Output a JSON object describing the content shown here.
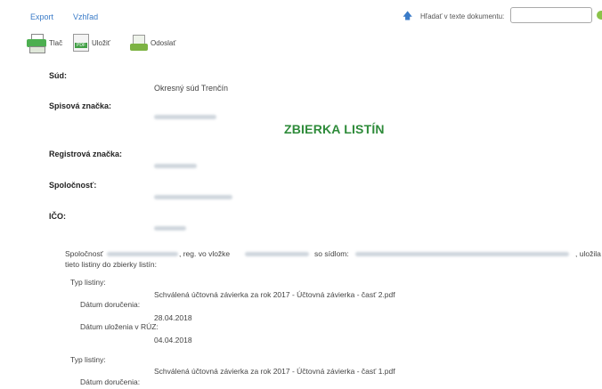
{
  "menu": {
    "export": "Export",
    "view": "Vzhľad"
  },
  "search": {
    "label": "Hľadať v texte dokumentu:",
    "value": "",
    "placeholder": ""
  },
  "toolbar": {
    "print": "Tlač",
    "save": "Uložiť",
    "send": "Odoslať",
    "save_icon_text": "PDF"
  },
  "title": "ZBIERKA LISTÍN",
  "fields": {
    "court_label": "Súd:",
    "court_value": "Okresný súd Trenčín",
    "file_label": "Spisová značka:",
    "reg_label": "Registrová značka:",
    "company_label": "Spoločnosť:",
    "ico_label": "IČO:"
  },
  "paragraph": {
    "part1": "Spoločnosť",
    "part2": ", reg. vo vložke",
    "part3": "so sídlom:",
    "part4": ", uložila",
    "line2": "tieto listiny do zbierky listín:"
  },
  "documents": {
    "labels": {
      "type": "Typ listiny:",
      "delivered": "Dátum doručenia:",
      "stored": "Dátum uloženia v RÚZ:"
    },
    "items": [
      {
        "type": "Schválená účtovná závierka za rok 2017 - Účtovná závierka - časť 2.pdf",
        "delivered": "28.04.2018",
        "stored": "04.04.2018"
      },
      {
        "type": "Schválená účtovná závierka za rok 2017 - Účtovná závierka - časť 1.pdf"
      }
    ]
  }
}
